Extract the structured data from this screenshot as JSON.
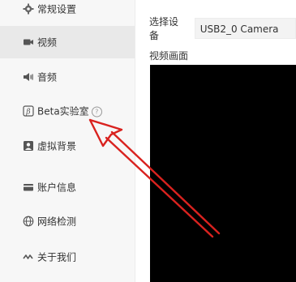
{
  "sidebar": {
    "items": [
      {
        "label": "常规设置",
        "icon": "gear-icon"
      },
      {
        "label": "视频",
        "icon": "video-camera-icon",
        "active": true
      },
      {
        "label": "音频",
        "icon": "speaker-icon"
      },
      {
        "label": "Beta实验室",
        "icon": "beta-icon",
        "help_icon": "?"
      },
      {
        "label": "虚拟背景",
        "icon": "portrait-icon"
      },
      {
        "label": "账户信息",
        "icon": "card-icon"
      },
      {
        "label": "网络检测",
        "icon": "globe-icon"
      },
      {
        "label": "关于我们",
        "icon": "wave-icon"
      }
    ]
  },
  "main": {
    "device_label": "选择设备",
    "device_value": "USB2_0 Camera",
    "preview_label": "视频画面"
  },
  "colors": {
    "sidebar_bg": "#f7f7f7",
    "active_bg": "#e9e9e9",
    "annotation_arrow": "#d9221f",
    "preview_bg": "#000000"
  }
}
